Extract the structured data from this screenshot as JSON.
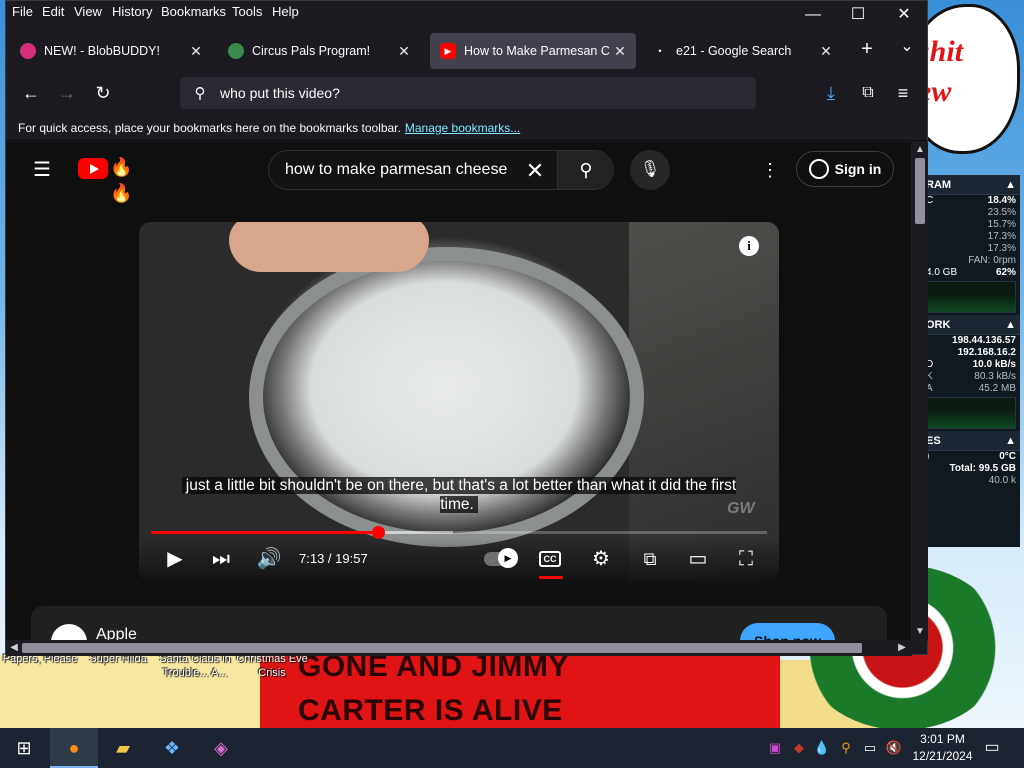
{
  "desktop": {
    "bubble_text": "shit\new",
    "banner_line1": "GONE AND JIMMY",
    "banner_line2": "CARTER IS ALIVE",
    "icons": [
      {
        "label": "Papers, Please"
      },
      {
        "label": "Super Hilda"
      },
      {
        "label": "Santa Claus in Trouble... A..."
      },
      {
        "label": "Christmas Eve Crisis"
      }
    ]
  },
  "monitor": {
    "ram_title": "RAM",
    "ram_rows": [
      {
        "k": "C",
        "v": "18.4%"
      },
      {
        "k": "",
        "v": "23.5%"
      },
      {
        "k": "",
        "v": "15.7%"
      },
      {
        "k": "",
        "v": "17.3%"
      },
      {
        "k": "",
        "v": "17.3%"
      },
      {
        "k": "",
        "v": "FAN: 0rpm"
      },
      {
        "k": "4.0 GB",
        "v": "62%"
      }
    ],
    "network_title": "ORK",
    "network_rows": [
      {
        "k": "",
        "v": "198.44.136.57"
      },
      {
        "k": "",
        "v": "192.168.16.2"
      },
      {
        "k": "D",
        "v": "10.0 kB/s"
      },
      {
        "k": "K",
        "v": "80.3 kB/s"
      },
      {
        "k": "A",
        "v": "45.2 MB"
      }
    ],
    "drives_title": "ES",
    "drives_rows": [
      {
        "k": ")",
        "v": "0°C"
      },
      {
        "k": "",
        "v": "Total: 99.5 GB"
      },
      {
        "k": "",
        "v": "40.0 k"
      }
    ]
  },
  "browser": {
    "menu": [
      "File",
      "Edit",
      "View",
      "History",
      "Bookmarks",
      "Tools",
      "Help"
    ],
    "window_controls": {
      "minimize": "—",
      "maximize": "☐",
      "close": "✕"
    },
    "tabs": [
      {
        "title": "NEW! - BlobBUDDY!",
        "active": false,
        "favicon_color": "#d4307a"
      },
      {
        "title": "Circus Pals Program!",
        "active": false,
        "favicon_color": "#3a8a4a"
      },
      {
        "title": "How to Make Parmesan Ch",
        "active": true,
        "favicon_color": "#ff0000"
      },
      {
        "title": "e21 - Google Search",
        "active": false,
        "favicon_color": "#4285f4"
      }
    ],
    "new_tab": "+",
    "tab_list": "⌄",
    "url_value": "who put this video?",
    "bookmarks_msg": "For quick access, place your bookmarks here on the bookmarks toolbar.",
    "bookmarks_link": "Manage bookmarks..."
  },
  "youtube": {
    "search_value": "how to make parmesan cheese",
    "signin_label": "Sign in",
    "video": {
      "caption": "just a little bit shouldn't be on there, but that's a lot better than what it did the first time.",
      "time_current": "7:13",
      "time_total": "19:57",
      "time_display": "7:13 / 19:57",
      "progress_fraction": 0.3689,
      "buffered_fraction": 0.49,
      "watermark": "GW",
      "cc_label": "CC"
    },
    "ad": {
      "title": "Apple",
      "cta": "Shop now"
    }
  },
  "taskbar": {
    "clock_time": "3:01 PM",
    "clock_date": "12/21/2024"
  },
  "colors": {
    "accent_red": "#ff0000",
    "link": "#80ebff",
    "browser_bg": "#1c1b22",
    "yt_bg": "#0f0f0f"
  }
}
